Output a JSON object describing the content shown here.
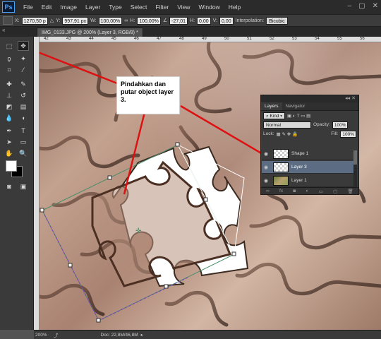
{
  "app": {
    "logo": "Ps",
    "menu": [
      "File",
      "Edit",
      "Image",
      "Layer",
      "Type",
      "Select",
      "Filter",
      "View",
      "Window",
      "Help"
    ],
    "window_controls": [
      "–",
      "▢",
      "✕"
    ]
  },
  "options_bar": {
    "x_label": "X:",
    "x_value": "1270,50 p",
    "y_label": "Y:",
    "y_value": "997,91 px",
    "w_label": "W:",
    "w_value": "100,00%",
    "h_label": "H:",
    "h_value": "100,00%",
    "angle_value": "-27,01",
    "h_skew_label": "H:",
    "h_skew_value": "0,00",
    "v_skew_label": "V:",
    "v_skew_value": "0,00",
    "interpolation_label": "Interpolation:",
    "interpolation_value": "Bicubic"
  },
  "document": {
    "tab_title": "IMG_0133.JPG @ 200% (Layer 3, RGB/8) *",
    "ruler_ticks": [
      "42",
      "43",
      "44",
      "45",
      "46",
      "47",
      "48",
      "49",
      "50",
      "51",
      "52",
      "53",
      "54",
      "55",
      "56"
    ]
  },
  "status": {
    "zoom": "200%",
    "doc_size": "Doc: 22,8M/46,8M"
  },
  "callout": {
    "text": "Pindahkan dan putar object layer 3."
  },
  "layers_panel": {
    "tabs": [
      "Layers",
      "Navigator"
    ],
    "kind_label": "Kind",
    "blend_mode": "Normal",
    "opacity_label": "Opacity:",
    "opacity_value": "100%",
    "lock_label": "Lock:",
    "fill_label": "Fill:",
    "fill_value": "100%",
    "layers": [
      {
        "name": "Shape 1",
        "selected": false
      },
      {
        "name": "Layer 3",
        "selected": true
      },
      {
        "name": "Layer 1",
        "selected": false
      }
    ],
    "footer_icons": [
      "link-icon",
      "fx-icon",
      "mask-icon",
      "adjustment-icon",
      "folder-icon",
      "new-layer-icon",
      "trash-icon"
    ]
  },
  "colors": {
    "annotation": "#dd1111",
    "selection": "#4a8e6a",
    "transform_edge": "#7a3fb8"
  }
}
